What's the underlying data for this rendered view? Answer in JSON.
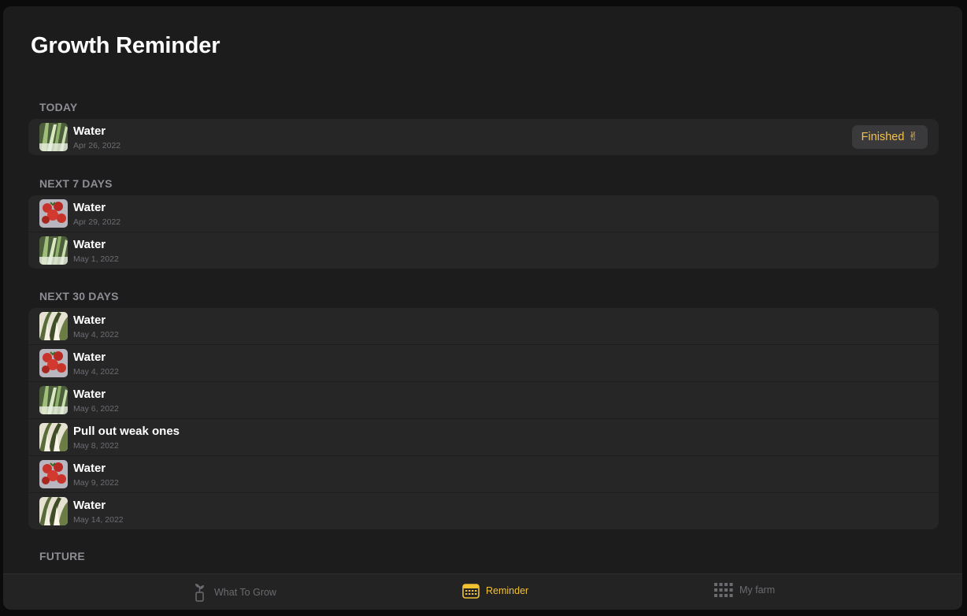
{
  "page_title": "Growth Reminder",
  "sections": [
    {
      "header": "TODAY",
      "items": [
        {
          "title": "Water",
          "date": "Apr 26, 2022",
          "plant": "leek",
          "action": "Finished",
          "action_emoji": "✌"
        }
      ]
    },
    {
      "header": "NEXT 7 DAYS",
      "items": [
        {
          "title": "Water",
          "date": "Apr 29, 2022",
          "plant": "strawberry"
        },
        {
          "title": "Water",
          "date": "May 1, 2022",
          "plant": "leek"
        }
      ]
    },
    {
      "header": "NEXT 30 DAYS",
      "items": [
        {
          "title": "Water",
          "date": "May 4, 2022",
          "plant": "bokchoy"
        },
        {
          "title": "Water",
          "date": "May 4, 2022",
          "plant": "strawberry"
        },
        {
          "title": "Water",
          "date": "May 6, 2022",
          "plant": "leek"
        },
        {
          "title": "Pull out weak ones",
          "date": "May 8, 2022",
          "plant": "bokchoy"
        },
        {
          "title": "Water",
          "date": "May 9, 2022",
          "plant": "strawberry"
        },
        {
          "title": "Water",
          "date": "May 14, 2022",
          "plant": "bokchoy"
        }
      ]
    },
    {
      "header": "FUTURE",
      "items": []
    }
  ],
  "tabs": [
    {
      "label": "What To Grow",
      "icon": "seedling-icon",
      "active": false
    },
    {
      "label": "Reminder",
      "icon": "calendar-icon",
      "active": true
    },
    {
      "label": "My farm",
      "icon": "grid-icon",
      "active": false
    }
  ],
  "colors": {
    "accent": "#f1c232",
    "background": "#1c1c1d",
    "row": "#262627"
  }
}
